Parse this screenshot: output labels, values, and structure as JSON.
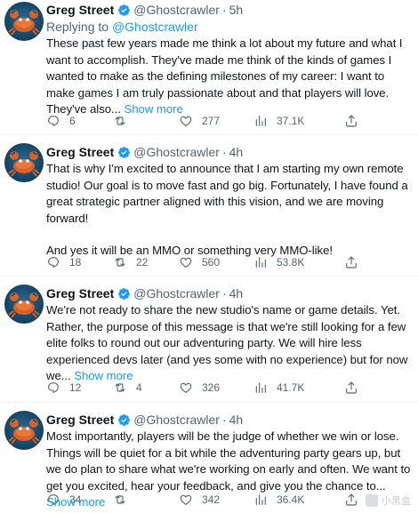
{
  "tweets": [
    {
      "name": "Greg Street",
      "handle": "@Ghostcrawler",
      "separator": "·",
      "time": "5h",
      "reply_prefix": "Replying to",
      "reply_to": "@Ghostcrawler",
      "paragraphs": [
        "These past few years made me think a lot about my future and what I want to accomplish. They've made me think of the kinds of games I wanted to make as the defining milestones of my career: I want to make games I am truly passionate about and that players will love. They've also..."
      ],
      "show_more": "Show more",
      "replies": "6",
      "retweets": "",
      "likes": "277",
      "views": "37.1K"
    },
    {
      "name": "Greg Street",
      "handle": "@Ghostcrawler",
      "separator": "·",
      "time": "4h",
      "paragraphs": [
        "That is why I'm excited to announce that I am starting my own remote studio! Our goal is to move fast and go big. Fortunately, I have found a great strategic partner aligned with this vision, and we are moving forward!",
        "And yes it will be an MMO or something very MMO-like!"
      ],
      "show_more": "",
      "replies": "18",
      "retweets": "22",
      "likes": "560",
      "views": "53.8K"
    },
    {
      "name": "Greg Street",
      "handle": "@Ghostcrawler",
      "separator": "·",
      "time": "4h",
      "paragraphs": [
        "We're not ready to share the new studio's name or game details. Yet. Rather, the purpose of this message is that we're still looking for a few elite folks to round out our adventuring party. We will hire less experienced devs later (and yes some with no experience) but for now we..."
      ],
      "show_more": "Show more",
      "replies": "12",
      "retweets": "4",
      "likes": "326",
      "views": "41.7K"
    },
    {
      "name": "Greg Street",
      "handle": "@Ghostcrawler",
      "separator": "·",
      "time": "4h",
      "paragraphs": [
        "Most importantly, players will be the judge of whether we win or lose. Things will be quiet for a bit while the adventuring party gears up, but we do plan to share what we're working on early and often. We want to get you excited, hear your feedback, and give you the chance to..."
      ],
      "show_more": "Show more",
      "replies": "34",
      "retweets": "",
      "likes": "342",
      "views": "36.4K"
    }
  ],
  "watermark": "小黑盒",
  "colors": {
    "link": "#1d9bf0",
    "secondary_text": "#536471",
    "verified": "#1d9bf0",
    "avatar_bg": "#13405e",
    "crab": "#d9622b"
  },
  "icons": [
    "verified-badge-icon",
    "reply-icon",
    "retweet-icon",
    "like-icon",
    "views-icon",
    "share-icon",
    "crab-avatar"
  ]
}
